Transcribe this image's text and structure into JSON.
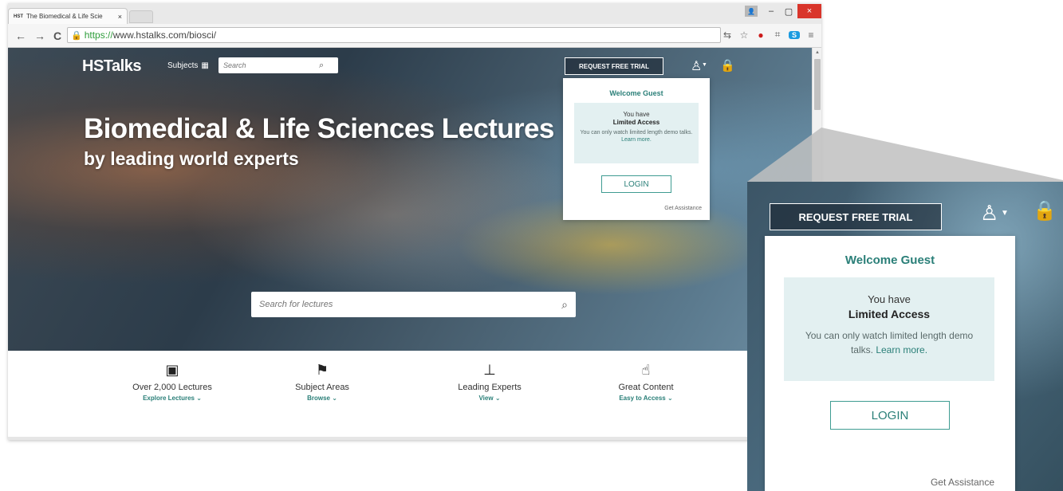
{
  "browser": {
    "tab": {
      "favicon": "HST",
      "title": "The Biomedical & Life Scie",
      "close": "×"
    },
    "window_controls": {
      "user": "👤",
      "minimize": "–",
      "maximize": "▢",
      "close": "×"
    },
    "nav": {
      "back": "←",
      "forward": "→",
      "reload": "C"
    },
    "url": {
      "scheme": "https://",
      "rest": "www.hstalks.com/biosci/"
    }
  },
  "site": {
    "logo": "HSTalks",
    "subjects_label": "Subjects",
    "top_search_placeholder": "Search",
    "hero_title": "Biomedical & Life Sciences Lectures",
    "hero_subtitle": "by leading world experts",
    "trial_button": "REQUEST FREE TRIAL",
    "main_search_placeholder": "Search for lectures",
    "features": [
      {
        "title": "Over 2,000 Lectures",
        "link": "Explore Lectures",
        "icon": "lecture-icon"
      },
      {
        "title": "Subject Areas",
        "link": "Browse",
        "icon": "flag-icon"
      },
      {
        "title": "Leading Experts",
        "link": "View",
        "icon": "presenter-icon"
      },
      {
        "title": "Great Content",
        "link": "Easy to Access",
        "icon": "hand-pointer-icon"
      }
    ]
  },
  "dropdown": {
    "welcome": "Welcome Guest",
    "you_have": "You have",
    "limited_access": "Limited Access",
    "note": "You can only watch limited length demo talks.",
    "learn_more": "Learn more.",
    "login": "LOGIN",
    "assist": "Get Assistance"
  },
  "colors": {
    "accent": "#2a7f78",
    "access_box_bg": "#e3f0f1",
    "close_button": "#d9352b",
    "secure_url": "#2e9d3a"
  }
}
